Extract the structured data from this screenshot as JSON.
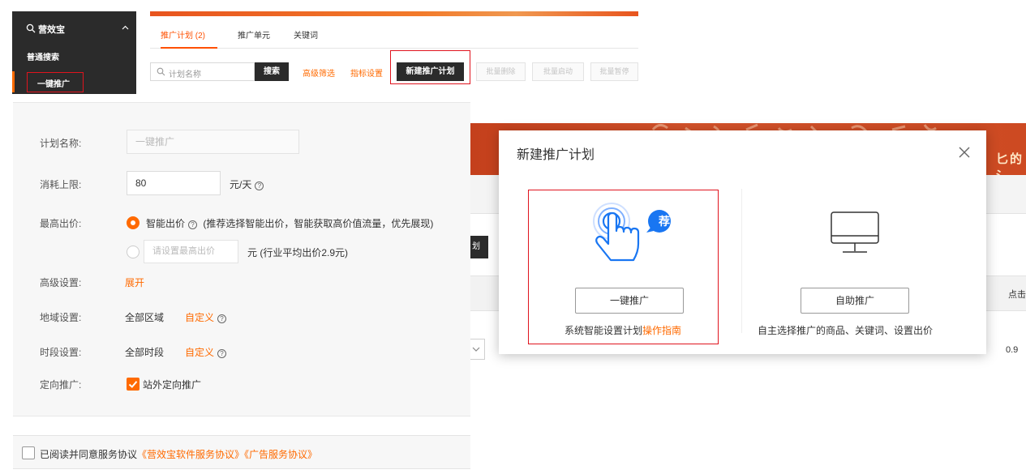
{
  "sidebar": {
    "header": "营效宝",
    "items": [
      "普通搜索",
      "一键推广"
    ]
  },
  "tabs": [
    "推广计划 (2)",
    "推广单元",
    "关键词"
  ],
  "toolbar": {
    "search_placeholder": "计划名称",
    "search_button": "搜索",
    "links": [
      "高级筛选",
      "指标设置"
    ],
    "new_plan_button": "新建推广计划",
    "batch_buttons": [
      "批量删除",
      "批量启动",
      "批量暂停"
    ]
  },
  "form": {
    "plan_name": {
      "label": "计划名称:",
      "value": "一键推广"
    },
    "budget": {
      "label": "消耗上限:",
      "value": "80",
      "unit": "元/天"
    },
    "max_bid": {
      "label": "最高出价:",
      "option_smart": "智能出价",
      "smart_note": "(推荐选择智能出价，智能获取高价值流量，优先展现)",
      "manual_placeholder": "请设置最高出价",
      "manual_note": "元 (行业平均出价2.9元)",
      "selected": "smart"
    },
    "advanced": {
      "label": "高级设置:",
      "link": "展开"
    },
    "region": {
      "label": "地域设置:",
      "value": "全部区域",
      "link": "自定义"
    },
    "time": {
      "label": "时段设置:",
      "value": "全部时段",
      "link": "自定义"
    },
    "targeting": {
      "label": "定向推广:",
      "value": "站外定向推广",
      "checked": true
    }
  },
  "agreement": {
    "prefix": "已阅读并同意服务协议",
    "links": [
      "《营效宝软件服务协议》",
      "《广告服务协议》"
    ]
  },
  "background": {
    "banner_text": "匕的 氵",
    "button_fragment": "划",
    "header_fragment": "点击",
    "cell_value": "0.9"
  },
  "modal": {
    "title": "新建推广计划",
    "badge": "荐",
    "option1": {
      "button": "一键推广",
      "desc": "系统智能设置计划",
      "link": "操作指南"
    },
    "option2": {
      "button": "自助推广",
      "desc": "自主选择推广的商品、关键词、设置出价"
    }
  },
  "colors": {
    "accent": "#ff6a00",
    "highlight": "#e0141e",
    "dark": "#2b2b2b",
    "info_blue": "#1976f2"
  }
}
